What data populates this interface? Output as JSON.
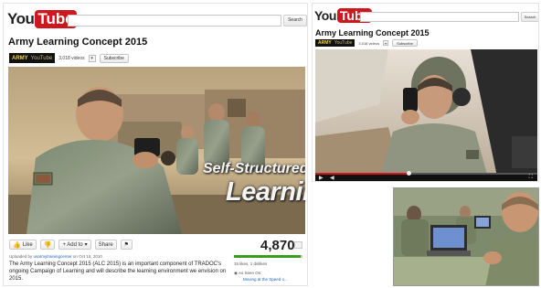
{
  "left_page": {
    "logo": {
      "you": "You",
      "tube": "Tube"
    },
    "search": {
      "value": "",
      "button_label": "Search"
    },
    "video_title": "Army Learning Concept 2015",
    "channel": {
      "badge": "ARMY",
      "badge_sub": "YouTube",
      "video_count": "3,018 videos",
      "subscribe_label": "Subscribe"
    },
    "overlay": {
      "line1": "Self-Structured",
      "line2": "Learning"
    },
    "actions": {
      "like_label": "Like",
      "add_label": "+ Add to",
      "share_label": "Share"
    },
    "view_count": "4,870",
    "like_ratio": 0.97,
    "uploaded_by": "Uploaded by",
    "uploader": "usarmytrainingcenter",
    "upload_date": "on Oct 15, 2010",
    "description": "The Army Learning Concept 2015 (ALC 2015) is an important component of TRADOC's ongoing Campaign of Learning and will describe the learning environment we envision on 2015.",
    "likes_text": "15 likes, 1 dislikes",
    "seen_on": "As Seen On:",
    "seen_on_link": "Moving at the Speed o..."
  },
  "right_page": {
    "logo": {
      "you": "You",
      "tube": "Tube"
    },
    "search": {
      "value": "",
      "button_label": "Search"
    },
    "video_title": "Army Learning Concept 2015",
    "channel": {
      "badge": "ARMY",
      "badge_sub": "YouTube",
      "video_count": "3,018 videos",
      "subscribe_label": "Subscribe"
    },
    "playback_fraction": 0.42
  },
  "colors": {
    "brand_red": "#cc181e",
    "like_green": "#3c9b1f",
    "link_blue": "#1c62b9",
    "army_gold": "#f2d25b"
  },
  "icons": {
    "thumbs_up": "thumbs-up-icon",
    "thumbs_down": "thumbs-down-icon",
    "flag": "flag-icon",
    "play": "play-icon",
    "volume": "volume-icon",
    "fullscreen": "fullscreen-icon"
  }
}
